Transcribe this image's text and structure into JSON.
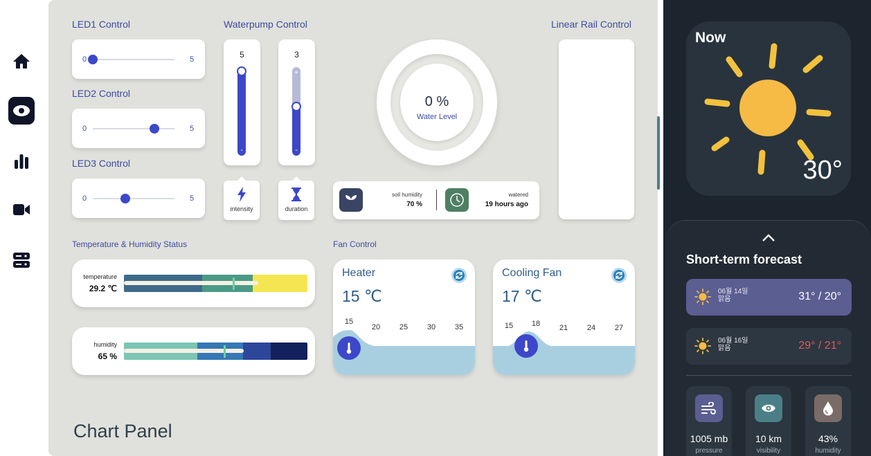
{
  "sidebar": {
    "items": [
      {
        "icon": "home-icon"
      },
      {
        "icon": "eye-icon"
      },
      {
        "icon": "bar-chart-icon"
      },
      {
        "icon": "video-camera-icon"
      },
      {
        "icon": "server-icon"
      }
    ]
  },
  "led": {
    "items": [
      {
        "title": "LED1 Control",
        "min": "0",
        "max": "5",
        "level": 0
      },
      {
        "title": "LED2 Control",
        "min": "0",
        "max": "5",
        "level": 0.75
      },
      {
        "title": "LED3 Control",
        "min": "0",
        "max": "5",
        "level": 0.4
      }
    ]
  },
  "waterpump": {
    "title": "Waterpump Control",
    "intensity": {
      "value": "5",
      "label": "intensity",
      "level": 1
    },
    "duration": {
      "value": "3",
      "label": "duration",
      "level": 0.6
    }
  },
  "water": {
    "value": "0 %",
    "label": "Water Level",
    "soil_label": "soil humidity",
    "soil_value": "70 %",
    "watered_label": "watered",
    "watered_value": "19 hours ago"
  },
  "linear_rail": {
    "title": "Linear Rail Control"
  },
  "th_status": {
    "title": "Temperature & Humidity Status",
    "temperature": {
      "label": "temperature",
      "value": "29.2 ℃"
    },
    "humidity": {
      "label": "humidity",
      "value": "65 %"
    }
  },
  "fan": {
    "title": "Fan Control",
    "heater": {
      "title": "Heater",
      "temp": "15 ℃",
      "ticks": [
        "15",
        "20",
        "25",
        "30",
        "35"
      ]
    },
    "cooling": {
      "title": "Cooling Fan",
      "temp": "17 ℃",
      "ticks": [
        "15",
        "18",
        "21",
        "24",
        "27"
      ]
    }
  },
  "chart_panel": {
    "title": "Chart Panel"
  },
  "weather": {
    "now_label": "Now",
    "now_temp": "30°",
    "forecast_title": "Short-term forecast",
    "forecast": [
      {
        "date": "06월 14일",
        "desc": "맑음",
        "temp": "31° / 20°",
        "temp_color": "#ffffff",
        "bg": "#5b5e91"
      },
      {
        "date": "06월 16일",
        "desc": "맑음",
        "temp": "29° / 21°",
        "temp_color": "#e25a5a",
        "bg": "#2d3741"
      }
    ],
    "stats": [
      {
        "value": "1005 mb",
        "label": "pressure",
        "icon": "wind-icon",
        "color": "#5b5e91"
      },
      {
        "value": "10 km",
        "label": "visibility",
        "icon": "eye-icon",
        "color": "#4b7f87"
      },
      {
        "value": "43%",
        "label": "humidity",
        "icon": "water-drop-icon",
        "color": "#7a6b67"
      }
    ]
  }
}
